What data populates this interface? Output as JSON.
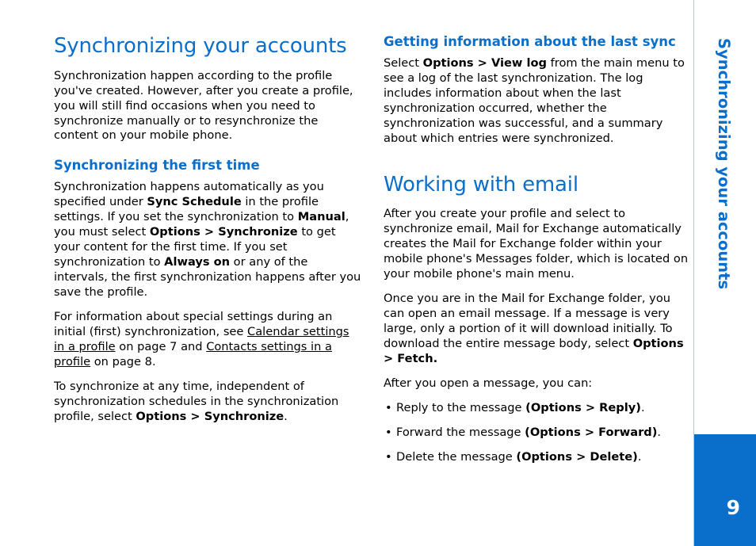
{
  "side_tab": {
    "title": "Synchronizing your accounts",
    "page_number": "9"
  },
  "left_column": {
    "heading": "Synchronizing your accounts",
    "intro_paragraph": "Synchronization happen according to the profile you've created. However, after you create a profile, you will still find occasions when you need to synchronize manually or to resynchronize the content on your mobile phone.",
    "subheading": "Synchronizing the first time",
    "para1": {
      "part1": "Synchronization happens automatically as you specified under ",
      "bold1": "Sync Schedule",
      "part2": " in the profile settings. If you set the synchronization to ",
      "bold2": "Manual",
      "part3": ", you must select ",
      "bold3": "Options > Synchronize",
      "part4": " to get your content for the first time. If you set synchronization to ",
      "bold4": "Always on",
      "part5": " or any of the intervals, the first synchronization happens after you save the profile."
    },
    "para2": {
      "part1": "For information about special settings during an initial (first) synchronization, see ",
      "link1": "Calendar settings in a profile",
      "part2": " on page 7 and ",
      "link2": "Contacts settings in a profile",
      "part3": " on page 8."
    },
    "para3": {
      "part1": "To synchronize at any time, independent of synchronization schedules in the synchronization profile, select ",
      "bold1": "Options > Synchronize",
      "part2": "."
    }
  },
  "right_column": {
    "heading1": "Getting information about the last sync",
    "para1": {
      "part1": "Select ",
      "bold1": "Options > View log",
      "part2": " from the main menu to see a log of the last synchronization. The log includes information about when the last synchronization occurred, whether the synchronization was successful, and a summary about which entries were synchronized."
    },
    "heading2": "Working with email",
    "para2": "After you create your profile and select to synchronize email, Mail for Exchange automatically creates the Mail for Exchange folder within your mobile phone's Messages folder, which is located on your mobile phone's main menu.",
    "para3": {
      "part1": "Once you are in the Mail for Exchange folder, you can open an email message. If a message is very large, only a portion of it will download initially. To download the entire message body, select ",
      "bold1": "Options > Fetch.",
      "part2": ""
    },
    "para4": "After you open a message, you can:",
    "bullets": [
      {
        "text": "Reply to the message ",
        "bold": "(Options > Reply)",
        "tail": "."
      },
      {
        "text": "Forward the message ",
        "bold": "(Options > Forward)",
        "tail": "."
      },
      {
        "text": "Delete the message ",
        "bold": "(Options > Delete)",
        "tail": "."
      }
    ]
  },
  "colors": {
    "accent": "#0a6ecb",
    "rule": "#b9c6d6"
  }
}
